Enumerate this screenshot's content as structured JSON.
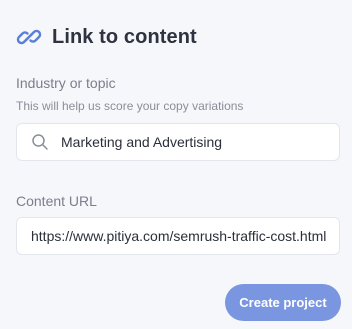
{
  "header": {
    "title": "Link to content",
    "icon": "link-icon"
  },
  "industry": {
    "label": "Industry or topic",
    "helper": "This will help us score your copy variations",
    "value": "Marketing and Advertising",
    "icon": "search-icon"
  },
  "content_url": {
    "label": "Content URL",
    "value": "https://www.pitiya.com/semrush-traffic-cost.html"
  },
  "actions": {
    "create_label": "Create project"
  },
  "colors": {
    "accent": "#7b96e0",
    "icon": "#5a7fd6",
    "background": "#f6f7fb"
  }
}
